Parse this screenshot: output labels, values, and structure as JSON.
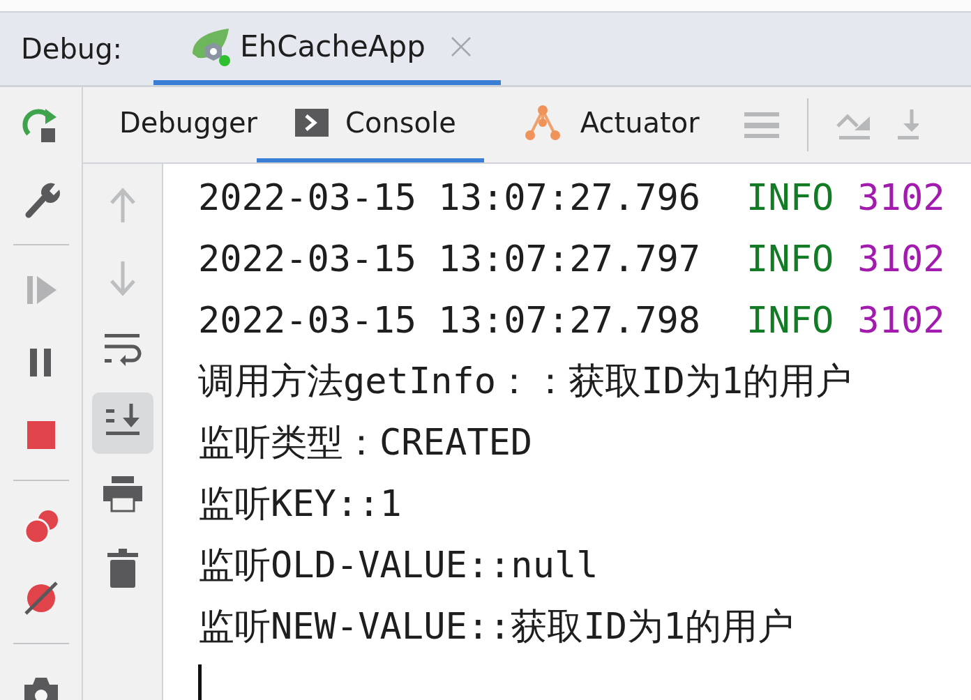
{
  "header": {
    "label": "Debug:",
    "tabs": [
      {
        "label": "EhCacheApp",
        "selected": true
      }
    ]
  },
  "left_toolbar": [
    {
      "items": [
        {
          "kind": "rerun",
          "disabled": false
        },
        {
          "kind": "settings",
          "disabled": false
        }
      ]
    },
    {
      "items": [
        {
          "kind": "resume",
          "disabled": true
        },
        {
          "kind": "pause",
          "disabled": false
        },
        {
          "kind": "stop",
          "disabled": false
        }
      ]
    },
    {
      "items": [
        {
          "kind": "breakpoints",
          "disabled": false
        },
        {
          "kind": "mute",
          "disabled": false
        }
      ]
    },
    {
      "items": [
        {
          "kind": "camera",
          "disabled": false
        }
      ]
    }
  ],
  "tabs": [
    {
      "label": "Debugger",
      "kind": "none",
      "selected": false
    },
    {
      "label": "Console",
      "kind": "console",
      "selected": true
    },
    {
      "label": "Actuator",
      "kind": "actuator",
      "selected": false
    }
  ],
  "side_toolbar": [
    {
      "kind": "up",
      "disabled": true,
      "selected": false
    },
    {
      "kind": "down",
      "disabled": true,
      "selected": false
    },
    {
      "kind": "wrap",
      "disabled": false,
      "selected": false
    },
    {
      "kind": "scroll-end",
      "disabled": false,
      "selected": true
    },
    {
      "kind": "print",
      "disabled": false,
      "selected": false
    },
    {
      "kind": "trash",
      "disabled": false,
      "selected": false
    }
  ],
  "console": [
    {
      "kind": "log",
      "time": "2022-03-15 13:07:27.796",
      "level": "INFO",
      "pid": "3102"
    },
    {
      "kind": "log",
      "time": "2022-03-15 13:07:27.797",
      "level": "INFO",
      "pid": "3102"
    },
    {
      "kind": "log",
      "time": "2022-03-15 13:07:27.798",
      "level": "INFO",
      "pid": "3102"
    },
    {
      "kind": "text",
      "text": "调用方法getInfo：：获取ID为1的用户"
    },
    {
      "kind": "text",
      "text": "监听类型：CREATED"
    },
    {
      "kind": "text",
      "text": "监听KEY::1"
    },
    {
      "kind": "text",
      "text": "监听OLD-VALUE::null"
    },
    {
      "kind": "text",
      "text": "监听NEW-VALUE::获取ID为1的用户"
    }
  ]
}
